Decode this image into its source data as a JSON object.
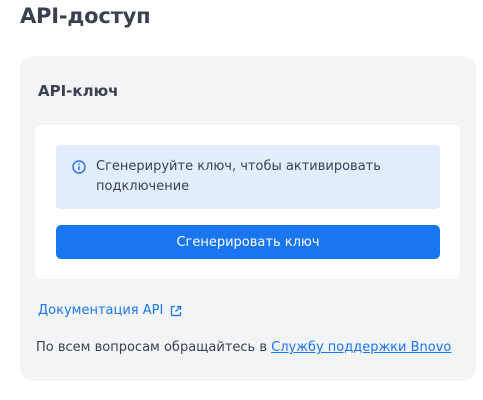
{
  "page": {
    "title": "API-доступ"
  },
  "api_card": {
    "title": "API-ключ",
    "notice_icon": "info-icon",
    "notice_text": "Сгенерируйте ключ, чтобы активировать подключение",
    "generate_label": "Сгенерировать ключ",
    "docs_link_label": "Документация API",
    "docs_link_icon": "external-link-icon",
    "support_prefix": "По всем вопросам обращайтесь в ",
    "support_link_label": "Службу поддержки Bnovo"
  },
  "colors": {
    "accent": "#1a76f0",
    "notice_bg": "#e3edfd",
    "card_bg": "#f3f4f6"
  }
}
